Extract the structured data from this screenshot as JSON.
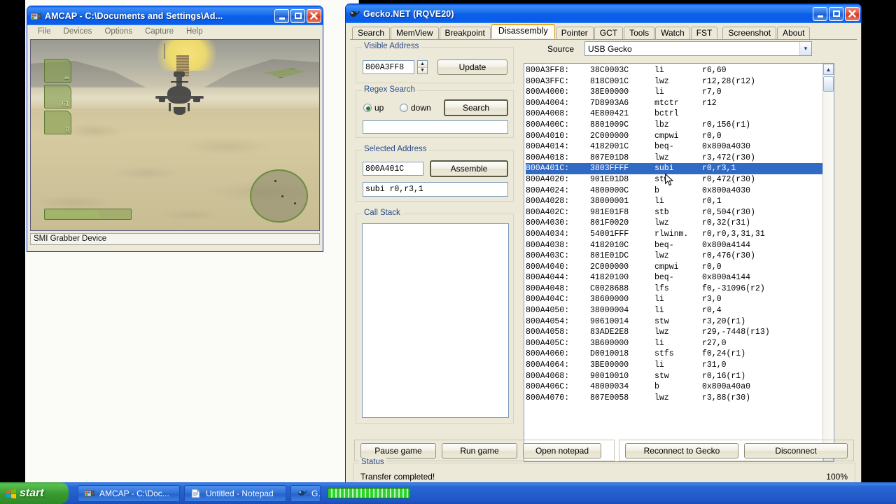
{
  "amcap": {
    "title": "AMCAP - C:\\Documents and Settings\\Ad...",
    "icon": "camera-icon",
    "menu": [
      "File",
      "Devices",
      "Options",
      "Capture",
      "Help"
    ],
    "status": "SMI Grabber Device",
    "window_buttons": {
      "minimize": "_",
      "maximize": "□",
      "close": "✕"
    },
    "hud": {
      "ammo": "∞",
      "rockets": "61",
      "missiles": "0"
    }
  },
  "gecko": {
    "title": "Gecko.NET (RQVE20)",
    "icon": "gecko-icon",
    "window_buttons": {
      "minimize": "_",
      "maximize": "□",
      "close": "✕"
    },
    "tabs": [
      {
        "label": "Search",
        "active": false
      },
      {
        "label": "MemView",
        "active": false
      },
      {
        "label": "Breakpoint",
        "active": false
      },
      {
        "label": "Disassembly",
        "active": true
      },
      {
        "label": "Pointer",
        "active": false
      },
      {
        "label": "GCT",
        "active": false
      },
      {
        "label": "Tools",
        "active": false
      },
      {
        "label": "Watch",
        "active": false
      },
      {
        "label": "FST",
        "active": false
      },
      {
        "label": "Screenshot",
        "active": false
      },
      {
        "label": "About",
        "active": false
      }
    ],
    "source": {
      "label": "Source",
      "value": "USB Gecko",
      "arrow": "▾"
    },
    "visible_address": {
      "group": "Visible Address",
      "value": "800A3FF8",
      "spinner_up": "▲",
      "spinner_down": "▼",
      "update_button": "Update"
    },
    "regex_search": {
      "group": "Regex Search",
      "radio_up": "up",
      "radio_down": "down",
      "selected": "up",
      "search_button": "Search",
      "query": ""
    },
    "selected_address": {
      "group": "Selected Address",
      "value": "800A401C",
      "assemble_button": "Assemble",
      "instruction": "subi r0,r3,1"
    },
    "call_stack": {
      "group": "Call Stack",
      "entries": []
    },
    "disassembly": {
      "selected_index": 9,
      "rows": [
        {
          "addr": "800A3FF8:",
          "hex": "38C0003C",
          "mn": "li",
          "ops": "r6,60"
        },
        {
          "addr": "800A3FFC:",
          "hex": "818C001C",
          "mn": "lwz",
          "ops": "r12,28(r12)"
        },
        {
          "addr": "800A4000:",
          "hex": "38E00000",
          "mn": "li",
          "ops": "r7,0"
        },
        {
          "addr": "800A4004:",
          "hex": "7D8903A6",
          "mn": "mtctr",
          "ops": "r12"
        },
        {
          "addr": "800A4008:",
          "hex": "4E800421",
          "mn": "bctrl",
          "ops": ""
        },
        {
          "addr": "800A400C:",
          "hex": "8801009C",
          "mn": "lbz",
          "ops": "r0,156(r1)"
        },
        {
          "addr": "800A4010:",
          "hex": "2C000000",
          "mn": "cmpwi",
          "ops": "r0,0"
        },
        {
          "addr": "800A4014:",
          "hex": "4182001C",
          "mn": "beq-",
          "ops": "0x800a4030"
        },
        {
          "addr": "800A4018:",
          "hex": "807E01D8",
          "mn": "lwz",
          "ops": "r3,472(r30)"
        },
        {
          "addr": "800A401C:",
          "hex": "3803FFFF",
          "mn": "subi",
          "ops": "r0,r3,1"
        },
        {
          "addr": "800A4020:",
          "hex": "901E01D8",
          "mn": "stw",
          "ops": "r0,472(r30)"
        },
        {
          "addr": "800A4024:",
          "hex": "4800000C",
          "mn": "b",
          "ops": "0x800a4030"
        },
        {
          "addr": "800A4028:",
          "hex": "38000001",
          "mn": "li",
          "ops": "r0,1"
        },
        {
          "addr": "800A402C:",
          "hex": "981E01F8",
          "mn": "stb",
          "ops": "r0,504(r30)"
        },
        {
          "addr": "800A4030:",
          "hex": "801F0020",
          "mn": "lwz",
          "ops": "r0,32(r31)"
        },
        {
          "addr": "800A4034:",
          "hex": "54001FFF",
          "mn": "rlwinm.",
          "ops": "r0,r0,3,31,31"
        },
        {
          "addr": "800A4038:",
          "hex": "4182010C",
          "mn": "beq-",
          "ops": "0x800a4144"
        },
        {
          "addr": "800A403C:",
          "hex": "801E01DC",
          "mn": "lwz",
          "ops": "r0,476(r30)"
        },
        {
          "addr": "800A4040:",
          "hex": "2C000000",
          "mn": "cmpwi",
          "ops": "r0,0"
        },
        {
          "addr": "800A4044:",
          "hex": "41820100",
          "mn": "beq-",
          "ops": "0x800a4144"
        },
        {
          "addr": "800A4048:",
          "hex": "C0028688",
          "mn": "lfs",
          "ops": "f0,-31096(r2)"
        },
        {
          "addr": "800A404C:",
          "hex": "38600000",
          "mn": "li",
          "ops": "r3,0"
        },
        {
          "addr": "800A4050:",
          "hex": "38000004",
          "mn": "li",
          "ops": "r0,4"
        },
        {
          "addr": "800A4054:",
          "hex": "90610014",
          "mn": "stw",
          "ops": "r3,20(r1)"
        },
        {
          "addr": "800A4058:",
          "hex": "83ADE2E8",
          "mn": "lwz",
          "ops": "r29,-7448(r13)"
        },
        {
          "addr": "800A405C:",
          "hex": "3B600000",
          "mn": "li",
          "ops": "r27,0"
        },
        {
          "addr": "800A4060:",
          "hex": "D0010018",
          "mn": "stfs",
          "ops": "f0,24(r1)"
        },
        {
          "addr": "800A4064:",
          "hex": "3BE00000",
          "mn": "li",
          "ops": "r31,0"
        },
        {
          "addr": "800A4068:",
          "hex": "90010010",
          "mn": "stw",
          "ops": "r0,16(r1)"
        },
        {
          "addr": "800A406C:",
          "hex": "48000034",
          "mn": "b",
          "ops": "0x800a40a0"
        },
        {
          "addr": "800A4070:",
          "hex": "807E0058",
          "mn": "lwz",
          "ops": "r3,88(r30)"
        }
      ],
      "scroll_up_arrow": "▲",
      "scroll_down_arrow": "▼"
    },
    "buttons": {
      "pause_game": "Pause game",
      "run_game": "Run game",
      "open_notepad": "Open notepad",
      "reconnect": "Reconnect to Gecko",
      "disconnect": "Disconnect"
    },
    "status": {
      "group": "Status",
      "message": "Transfer completed!",
      "percent": "100%",
      "progress_value": 100,
      "progress_color": "#2ed22e"
    }
  },
  "taskbar": {
    "start": "start",
    "items": [
      {
        "label": "AMCAP - C:\\Doc...",
        "icon": "camera-icon"
      },
      {
        "label": "Untitled - Notepad",
        "icon": "notepad-icon"
      },
      {
        "label": "G…",
        "icon": "gecko-icon"
      }
    ]
  },
  "theme": {
    "title_blue": "#0058ee",
    "face": "#ece9d8",
    "selection_blue": "#316ac5",
    "group_label": "#2a4b8d",
    "tab_active_border": "#f0a71c"
  }
}
